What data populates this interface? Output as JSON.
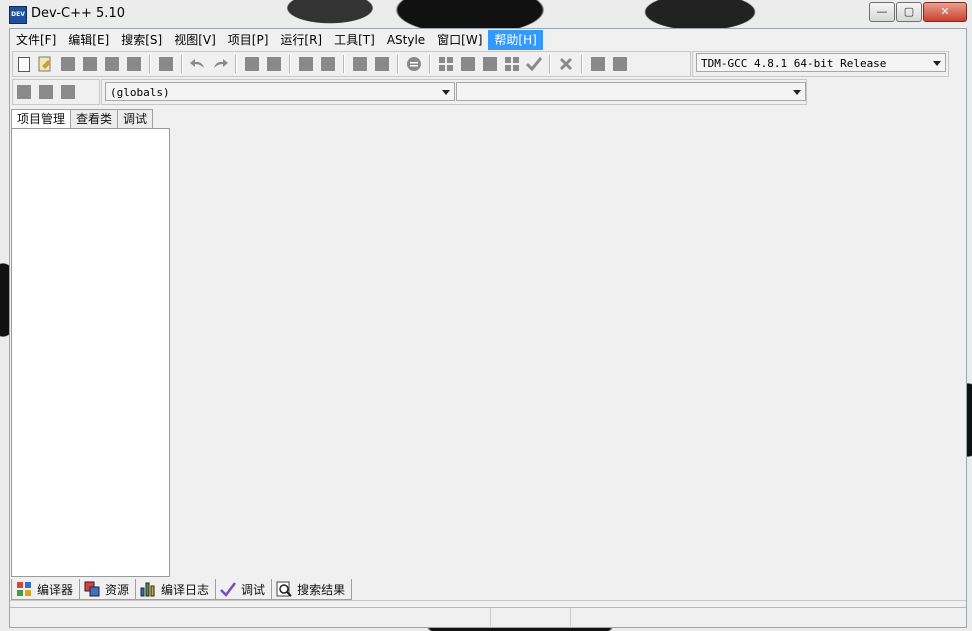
{
  "window": {
    "title": "Dev-C++ 5.10",
    "icon": "dev-cpp-app-icon"
  },
  "window_controls": {
    "minimize": "—",
    "maximize": "▢",
    "close": "✕"
  },
  "menu": [
    {
      "label": "文件[F]"
    },
    {
      "label": "编辑[E]"
    },
    {
      "label": "搜索[S]"
    },
    {
      "label": "视图[V]"
    },
    {
      "label": "项目[P]"
    },
    {
      "label": "运行[R]"
    },
    {
      "label": "工具[T]"
    },
    {
      "label": "AStyle"
    },
    {
      "label": "窗口[W]"
    },
    {
      "label": "帮助[H]"
    }
  ],
  "compiler_select": {
    "value": "TDM-GCC 4.8.1 64-bit Release"
  },
  "scope_select": {
    "value": "(globals)"
  },
  "symbol_select": {
    "value": ""
  },
  "left_tabs": [
    {
      "label": "项目管理"
    },
    {
      "label": "查看类"
    },
    {
      "label": "调试"
    }
  ],
  "bottom_tabs": [
    {
      "label": "编译器",
      "icon": "compiler-grid-icon"
    },
    {
      "label": "资源",
      "icon": "resources-icon"
    },
    {
      "label": "编译日志",
      "icon": "bar-chart-icon"
    },
    {
      "label": "调试",
      "icon": "checkmark-icon"
    },
    {
      "label": "搜索结果",
      "icon": "magnifier-icon"
    }
  ],
  "colors": {
    "accent": "#3399ff",
    "frame_border": "#9aa6b4",
    "close_button": "#c8422e"
  }
}
